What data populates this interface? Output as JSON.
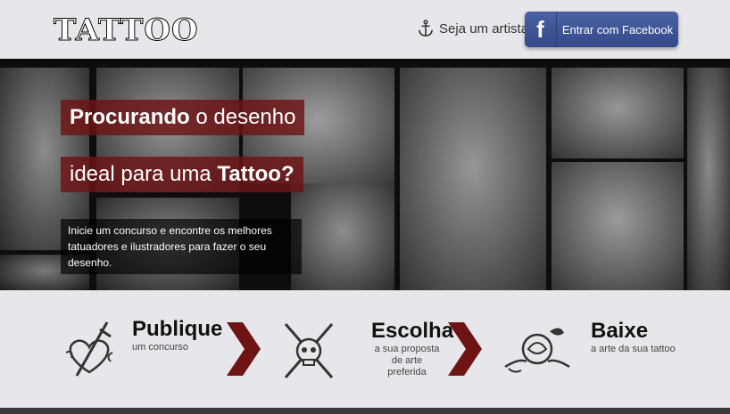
{
  "header": {
    "logo_text": "TATTOO",
    "artist_link_label": "Seja um artista",
    "facebook_button_label": "Entrar com Facebook"
  },
  "hero": {
    "line1_bold": "Procurando",
    "line1_rest": " o desenho",
    "line2_rest": "ideal para uma ",
    "line2_bold": "Tattoo?",
    "subtext": "Inicie um concurso e encontre os melhores tatuadores e ilustradores para fazer o seu desenho."
  },
  "steps": [
    {
      "title": "Publique",
      "subtitle": "um concurso",
      "icon": "heart-dagger-icon"
    },
    {
      "title": "Escolha",
      "subtitle": "a sua proposta de arte preferida",
      "icon": "skull-daggers-icon"
    },
    {
      "title": "Baixe",
      "subtitle": "a arte da sua tattoo",
      "icon": "rose-icon"
    }
  ],
  "colors": {
    "background": "#e7e6ea",
    "accent_red": "#6e1414",
    "facebook_blue": "#3b5998"
  }
}
